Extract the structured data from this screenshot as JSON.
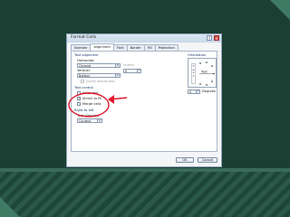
{
  "dialog": {
    "title": "Format Cells",
    "help_glyph": "?",
    "close_glyph": "x"
  },
  "tabs": [
    {
      "label": "Number"
    },
    {
      "label": "Alignment",
      "active": true
    },
    {
      "label": "Font"
    },
    {
      "label": "Border"
    },
    {
      "label": "Fill"
    },
    {
      "label": "Protection"
    }
  ],
  "text_alignment": {
    "section_label": "Text alignment",
    "horizontal_label": "Horizontal:",
    "horizontal_value": "General",
    "indent_label": "Indent:",
    "indent_value": "0",
    "vertical_label": "Vertical:",
    "vertical_value": "Bottom",
    "justify_distributed_label": "Justify distributed"
  },
  "text_control": {
    "section_label": "Text control",
    "wrap_text_label": "Wrap text",
    "wrap_text_checked": false,
    "shrink_to_fit_label": "Shrink to fit",
    "shrink_to_fit_checked": true,
    "merge_cells_label": "Merge cells",
    "merge_cells_checked": false
  },
  "right_to_left": {
    "section_label": "Right-to-left",
    "text_direction_label": "Text direction:",
    "text_direction_value": "Context"
  },
  "orientation": {
    "section_label": "Orientation",
    "vertical_text": "T e x t",
    "dial_text": "Text",
    "degrees_value": "0",
    "degrees_label": "Degrees"
  },
  "footer": {
    "ok_label": "OK",
    "cancel_label": "Cancel"
  },
  "annotation": {
    "color": "#e0182d"
  }
}
